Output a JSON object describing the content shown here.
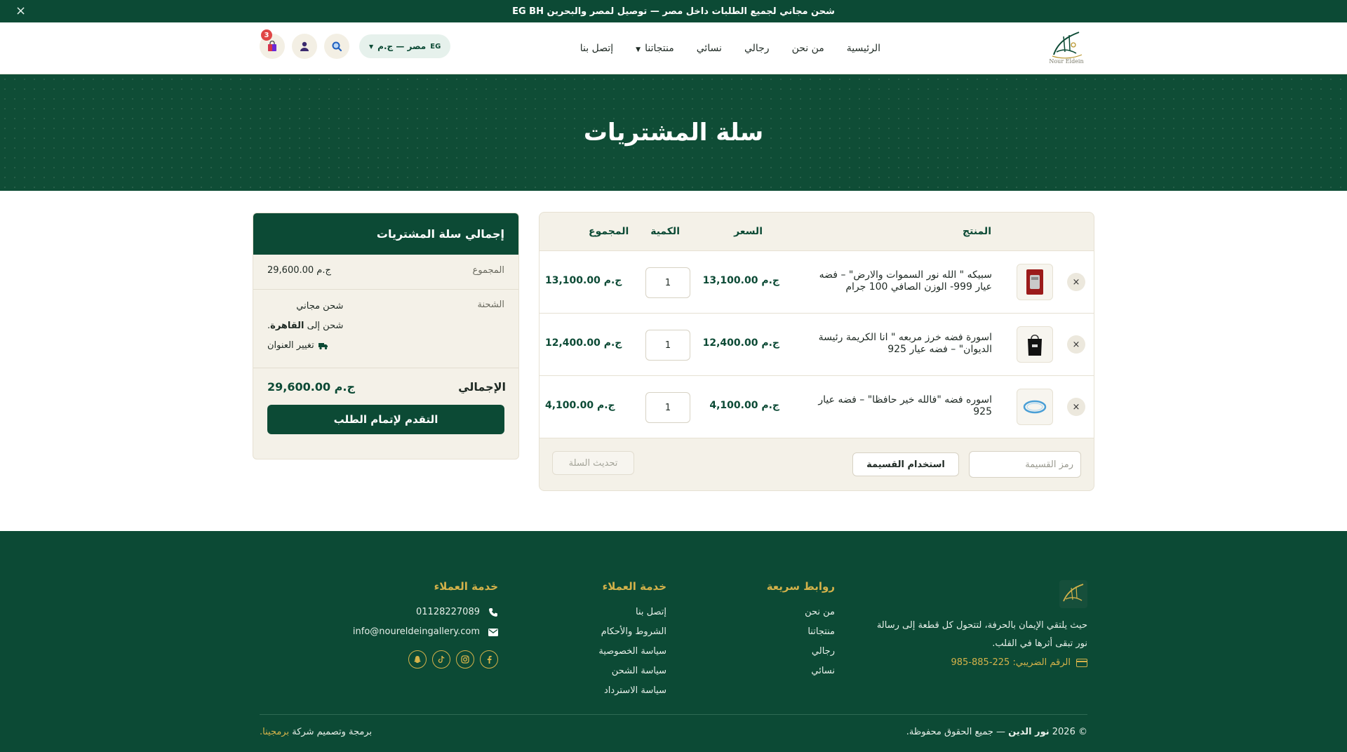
{
  "announcement": {
    "text": "شحن مجاني لجميع الطلبات داخل مصر — توصيل لمصر والبحرين EG BH",
    "close": "×"
  },
  "header": {
    "logo_caption": "Nour Eldein",
    "nav": [
      "الرئيسية",
      "من نحن",
      "رجالي",
      "نسائي",
      "منتجاتنا",
      "إتصل بنا"
    ],
    "currency_code": "EG",
    "currency_label": "مصر — ج.م",
    "cart_count": "3"
  },
  "hero": {
    "title": "سلة المشتريات"
  },
  "cart": {
    "columns": {
      "product": "المنتج",
      "price": "السعر",
      "qty": "الكمية",
      "total": "المجموع"
    },
    "items": [
      {
        "name": "سبيكه \" الله نور السموات والارض\" – فضه عيار 999- الوزن الصافي 100 جرام",
        "price": "13,100.00 ج.م",
        "qty": "1",
        "total": "13,100.00 ج.م"
      },
      {
        "name": "اسورة فضه خرز مربعه \" انا الكريمة رئيسة الديوان\" – فضه عيار 925",
        "price": "12,400.00 ج.م",
        "qty": "1",
        "total": "12,400.00 ج.م"
      },
      {
        "name": "اسوره فضه \"فالله خير حافظا\" – فضه عيار 925",
        "price": "4,100.00 ج.م",
        "qty": "1",
        "total": "4,100.00 ج.م"
      }
    ],
    "remove_symbol": "×",
    "coupon_placeholder": "رمز القسيمة",
    "apply_coupon": "استخدام القسيمة",
    "update_cart": "تحديث السلة"
  },
  "totals": {
    "title": "إجمالي سلة المشتريات",
    "subtotal_label": "المجموع",
    "subtotal_value": "29,600.00 ج.م",
    "shipping_label": "الشحنة",
    "shipping_method": "شحن مجاني",
    "shipping_to_prefix": "شحن إلى",
    "shipping_city": "القاهرة",
    "change_address": "تغيير العنوان",
    "total_label": "الإجمالي",
    "total_value": "29,600.00 ج.م",
    "checkout": "التقدم لإتمام الطلب"
  },
  "footer": {
    "about": "حيث يلتقي الإيمان بالحرفة، لتتحول كل قطعة إلى رسالة نور تبقى أثرها في القلب.",
    "tax": "الرقم الضريبي: 225-885-985",
    "quick_links_title": "روابط سريعة",
    "quick_links": [
      "من نحن",
      "منتجاتنا",
      "رجالي",
      "نسائي"
    ],
    "service_title": "خدمة العملاء",
    "service_links": [
      "إتصل بنا",
      "الشروط والأحكام",
      "سياسة الخصوصية",
      "سياسة الشحن",
      "سياسة الاسترداد"
    ],
    "contact_title": "خدمة العملاء",
    "phone": "01128227089",
    "email": "info@noureldeingallery.com",
    "copyright_prefix": "© 2026",
    "copyright_brand": "نور الدين",
    "copyright_suffix": "— جميع الحقوق محفوظة.",
    "credit_prefix": "برمجة وتصميم شركة",
    "credit_company": "برمجينا."
  },
  "colors": {
    "primary": "#0c4a35",
    "gold": "#d4b24a",
    "cream": "#f4f1e8",
    "badge": "#e04646"
  },
  "icons": [
    "close-icon",
    "cart-icon",
    "user-icon",
    "search-icon",
    "remove-icon",
    "truck-icon",
    "phone-icon",
    "mail-icon",
    "tax-card-icon",
    "facebook-icon",
    "instagram-icon",
    "tiktok-icon",
    "snapchat-icon"
  ]
}
